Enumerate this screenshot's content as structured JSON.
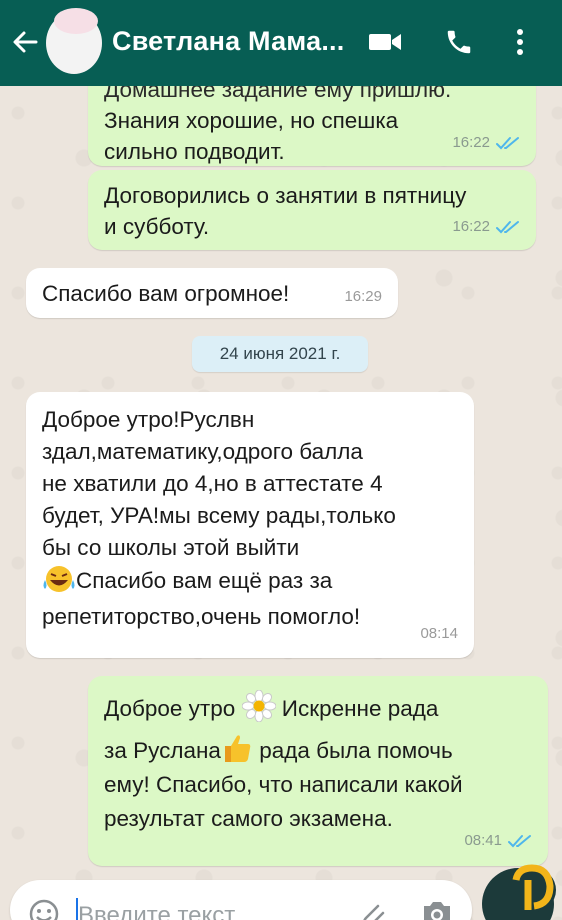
{
  "header": {
    "title": "Светлана Мама...",
    "colors": {
      "bar": "#075e54"
    },
    "icons": [
      "back-arrow-icon",
      "avatar",
      "video-call-icon",
      "phone-icon",
      "more-vert-icon"
    ]
  },
  "messages": {
    "m1": {
      "top_text": "Домашнее задание ему пришлю.",
      "line1": "Знания хорошие, но спешка",
      "line2": "сильно подводит.",
      "time": "16:22"
    },
    "m2": {
      "line1": "Договорились о занятии в пятницу",
      "line2": "и субботу.",
      "time": "16:22"
    },
    "m3": {
      "line1": "Спасибо вам огромное!",
      "time": "16:29"
    },
    "date_chip": "24 июня 2021 г.",
    "m4": {
      "line1": "Доброе утро!Руслвн",
      "line2": "здал,математику,одрого балла",
      "line3": "не хватили до 4,но в аттестате 4",
      "line4": "будет, УРА!мы всему рады,только",
      "line5": "бы со школы этой выйти",
      "line6": "Спасибо вам ещё раз за",
      "line7": "репетиторство,очень помогло!",
      "time": "08:14"
    },
    "m5": {
      "line1a": "Доброе утро",
      "line1b": "Искренне рада",
      "line2a": "за Руслана",
      "line2b": "рада была помочь",
      "line3": "ему! Спасибо, что написали какой",
      "line4": "результат самого экзамена.",
      "time": "08:41"
    }
  },
  "composer": {
    "placeholder": "Введите текст"
  },
  "colors": {
    "outgoing": "#dcf8c6",
    "incoming": "#ffffff",
    "read_ticks": "#4fb6ec"
  }
}
